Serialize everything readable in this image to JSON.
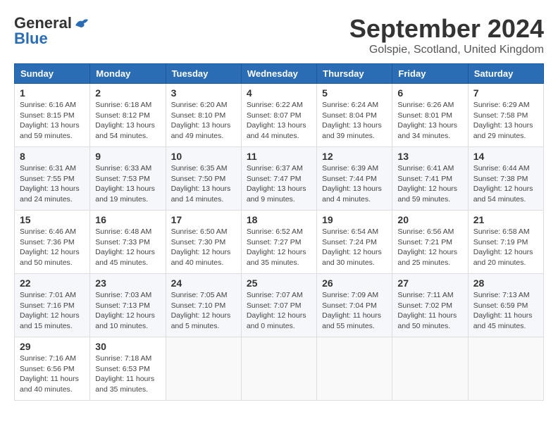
{
  "header": {
    "logo_general": "General",
    "logo_blue": "Blue",
    "month_title": "September 2024",
    "subtitle": "Golspie, Scotland, United Kingdom"
  },
  "columns": [
    "Sunday",
    "Monday",
    "Tuesday",
    "Wednesday",
    "Thursday",
    "Friday",
    "Saturday"
  ],
  "weeks": [
    [
      {
        "day": "1",
        "info": "Sunrise: 6:16 AM\nSunset: 8:15 PM\nDaylight: 13 hours\nand 59 minutes."
      },
      {
        "day": "2",
        "info": "Sunrise: 6:18 AM\nSunset: 8:12 PM\nDaylight: 13 hours\nand 54 minutes."
      },
      {
        "day": "3",
        "info": "Sunrise: 6:20 AM\nSunset: 8:10 PM\nDaylight: 13 hours\nand 49 minutes."
      },
      {
        "day": "4",
        "info": "Sunrise: 6:22 AM\nSunset: 8:07 PM\nDaylight: 13 hours\nand 44 minutes."
      },
      {
        "day": "5",
        "info": "Sunrise: 6:24 AM\nSunset: 8:04 PM\nDaylight: 13 hours\nand 39 minutes."
      },
      {
        "day": "6",
        "info": "Sunrise: 6:26 AM\nSunset: 8:01 PM\nDaylight: 13 hours\nand 34 minutes."
      },
      {
        "day": "7",
        "info": "Sunrise: 6:29 AM\nSunset: 7:58 PM\nDaylight: 13 hours\nand 29 minutes."
      }
    ],
    [
      {
        "day": "8",
        "info": "Sunrise: 6:31 AM\nSunset: 7:55 PM\nDaylight: 13 hours\nand 24 minutes."
      },
      {
        "day": "9",
        "info": "Sunrise: 6:33 AM\nSunset: 7:53 PM\nDaylight: 13 hours\nand 19 minutes."
      },
      {
        "day": "10",
        "info": "Sunrise: 6:35 AM\nSunset: 7:50 PM\nDaylight: 13 hours\nand 14 minutes."
      },
      {
        "day": "11",
        "info": "Sunrise: 6:37 AM\nSunset: 7:47 PM\nDaylight: 13 hours\nand 9 minutes."
      },
      {
        "day": "12",
        "info": "Sunrise: 6:39 AM\nSunset: 7:44 PM\nDaylight: 13 hours\nand 4 minutes."
      },
      {
        "day": "13",
        "info": "Sunrise: 6:41 AM\nSunset: 7:41 PM\nDaylight: 12 hours\nand 59 minutes."
      },
      {
        "day": "14",
        "info": "Sunrise: 6:44 AM\nSunset: 7:38 PM\nDaylight: 12 hours\nand 54 minutes."
      }
    ],
    [
      {
        "day": "15",
        "info": "Sunrise: 6:46 AM\nSunset: 7:36 PM\nDaylight: 12 hours\nand 50 minutes."
      },
      {
        "day": "16",
        "info": "Sunrise: 6:48 AM\nSunset: 7:33 PM\nDaylight: 12 hours\nand 45 minutes."
      },
      {
        "day": "17",
        "info": "Sunrise: 6:50 AM\nSunset: 7:30 PM\nDaylight: 12 hours\nand 40 minutes."
      },
      {
        "day": "18",
        "info": "Sunrise: 6:52 AM\nSunset: 7:27 PM\nDaylight: 12 hours\nand 35 minutes."
      },
      {
        "day": "19",
        "info": "Sunrise: 6:54 AM\nSunset: 7:24 PM\nDaylight: 12 hours\nand 30 minutes."
      },
      {
        "day": "20",
        "info": "Sunrise: 6:56 AM\nSunset: 7:21 PM\nDaylight: 12 hours\nand 25 minutes."
      },
      {
        "day": "21",
        "info": "Sunrise: 6:58 AM\nSunset: 7:19 PM\nDaylight: 12 hours\nand 20 minutes."
      }
    ],
    [
      {
        "day": "22",
        "info": "Sunrise: 7:01 AM\nSunset: 7:16 PM\nDaylight: 12 hours\nand 15 minutes."
      },
      {
        "day": "23",
        "info": "Sunrise: 7:03 AM\nSunset: 7:13 PM\nDaylight: 12 hours\nand 10 minutes."
      },
      {
        "day": "24",
        "info": "Sunrise: 7:05 AM\nSunset: 7:10 PM\nDaylight: 12 hours\nand 5 minutes."
      },
      {
        "day": "25",
        "info": "Sunrise: 7:07 AM\nSunset: 7:07 PM\nDaylight: 12 hours\nand 0 minutes."
      },
      {
        "day": "26",
        "info": "Sunrise: 7:09 AM\nSunset: 7:04 PM\nDaylight: 11 hours\nand 55 minutes."
      },
      {
        "day": "27",
        "info": "Sunrise: 7:11 AM\nSunset: 7:02 PM\nDaylight: 11 hours\nand 50 minutes."
      },
      {
        "day": "28",
        "info": "Sunrise: 7:13 AM\nSunset: 6:59 PM\nDaylight: 11 hours\nand 45 minutes."
      }
    ],
    [
      {
        "day": "29",
        "info": "Sunrise: 7:16 AM\nSunset: 6:56 PM\nDaylight: 11 hours\nand 40 minutes."
      },
      {
        "day": "30",
        "info": "Sunrise: 7:18 AM\nSunset: 6:53 PM\nDaylight: 11 hours\nand 35 minutes."
      },
      {
        "day": "",
        "info": ""
      },
      {
        "day": "",
        "info": ""
      },
      {
        "day": "",
        "info": ""
      },
      {
        "day": "",
        "info": ""
      },
      {
        "day": "",
        "info": ""
      }
    ]
  ]
}
